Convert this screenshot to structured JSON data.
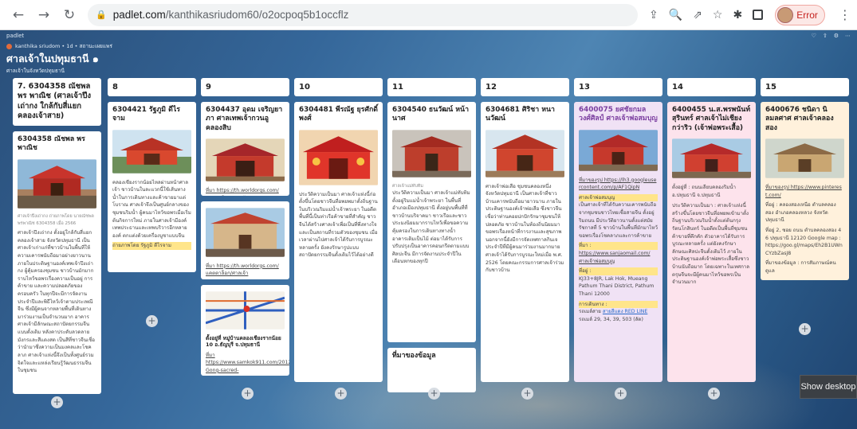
{
  "browser": {
    "url_domain": "padlet.com",
    "url_path": "/kanthikasriudom60/o2ocpoq5b1occflz",
    "profile_label": "Error"
  },
  "padlet": {
    "brand": "padlet",
    "meta_line": "kanthika sriudom • 1d • สถานะเผยแพร่",
    "title": "ศาลเจ้าในปทุมธานี ๑",
    "subtitle": "ศาลเจ้าในจังหวัดปทุมธานี"
  },
  "columns": [
    {
      "title": "7. 6304358 ณัชพล พร พาณิช (ศาลเจ้าปึงเถ่ากง ใกล้กับสี่แยกคลองเจ้าสาย)",
      "cards": [
        {
          "title": "6304358 ณัชพล พรพาณิช",
          "caption": "ศาลเจ้าปึงเถ่ากง ถ่ายภาพโดย นายณัชพล พรพาณิช 6304358 เมื่อ 2566",
          "body": "ศาลเจ้าปึงเถ่ากง ตั้งอยู่ใกล้กับสี่แยกคลองเจ้าสาย จังหวัดปทุมธานี เป็นศาลเจ้าเก่าแก่ที่ชาวบ้านในพื้นที่ให้ความเคารพนับถือมาอย่างยาวนาน ภายในประดิษฐานองค์เทพเจ้าปึงเถ่ากง ผู้คุ้มครองชุมชน ชาวบ้านมักมากราบไหว้ขอพรเรื่องความเป็นอยู่ การค้าขาย และความปลอดภัยของครอบครัว ในทุกปีจะมีการจัดงานประจำปีและพิธีไหว้เจ้าตามประเพณีจีน ซึ่งมีผู้คนจากหลายพื้นที่เดินทางมาร่วมงานเป็นจำนวนมาก อาคารศาลเจ้ามีลักษณะสถาปัตยกรรมจีนแบบดั้งเดิม หลังคาประดับลวดลายมังกรและสีแดงสด เป็นสีที่ชาวจีนเชื่อว่านำมาซึ่งความเป็นมงคลและโชคลาภ ศาลเจ้าแห่งนี้จึงเป็นทั้งศูนย์รวมจิตใจและแหล่งเรียนรู้วัฒนธรรมจีนในชุมชน"
        },
        {
          "title": "",
          "caption": "",
          "body": "ศาลเจ้าปึงเถ่ากง",
          "footer": "ศาลเจ้าปึงเถ่ากง"
        }
      ]
    },
    {
      "title": "8",
      "cards": [
        {
          "title": "6304421 รัฐภูมิ ดีไรจาม",
          "body": "คลองเชียงรากน้อยไหลผ่านหน้าศาลเจ้า ชาวบ้านในละแวกนี้ใช้เส้นทางน้ำในการเดินทางและค้าขายมาแต่โบราณ ศาลเจ้าจึงเป็นศูนย์กลางของชุมชนริมน้ำ ผู้คนมาไหว้ขอพรเมื่อเริ่มต้นกิจการใหม่ ภายในศาลเจ้ามีองค์เทพประธานและเทพบริวารอีกหลายองค์ ตกแต่งด้วยเครื่องบูชาแบบจีน",
          "note": "ถ่ายภาพโดย รัฐภูมิ ดีไรจาม"
        }
      ]
    },
    {
      "title": "9",
      "cards": [
        {
          "title": "6304437 อุดม เจริญยาภา ศาลเทพเจ้ากวนอูคลองสิบ",
          "link": "ที่มา https://th.worldorgs.com/แคตตาล็อก/ศาลเจ้ากวนอูคลองสิบ"
        },
        {
          "title": "",
          "link": "ที่มา https://th.worldorgs.com/แคตตาล็อก/ศาลเจ้า"
        },
        {
          "title": "ตั้งอยู่ที่ หมู่บ้านคลองเชียงรากน้อย 10 อ.ธัญบุรี จ.ปทุมธานี",
          "link": "ที่มา https://www.samkok911.com/2012/12/Guan-Gong-sacred-"
        }
      ]
    },
    {
      "title": "10",
      "cards": [
        {
          "title": "6304481 พีรณัฐ ยุรศักดิ์พงศ์",
          "body": "ประวัติความเป็นมา ศาลเจ้าแห่งนี้ก่อตั้งขึ้นโดยชาวจีนที่อพยพมาตั้งถิ่นฐานในบริเวณริมแม่น้ำเจ้าพระยา ในอดีตพื้นที่นี้เป็นท่าเรือค้าขายที่สำคัญ ชาวจีนได้สร้างศาลเจ้าเพื่อเป็นที่พึ่งทางใจ และเป็นสถานที่รวมตัวของชุมชน เมื่อเวลาผ่านไปศาลเจ้าได้รับการบูรณะหลายครั้ง ยังคงรักษารูปแบบสถาปัตยกรรมจีนดั้งเดิมไว้ได้อย่างดี"
        }
      ]
    },
    {
      "title": "11",
      "cards": [
        {
          "title": "6304540 ธนวัฒน์ หน้านาศ",
          "caption": "ศาลเจ้าแม่ทับทิม",
          "body": "ประวัติความเป็นมา ศาลเจ้าแม่ทับทิมตั้งอยู่ริมแม่น้ำเจ้าพระยา ในพื้นที่อำเภอเมืองปทุมธานี ตั้งอยู่บนพื้นที่ที่ชาวบ้านบริจาคมา ชาวเรือและชาวประมงนิยมมากราบไหว้เพื่อขอความคุ้มครองในการเดินทางทางน้ำ อาคารเดิมเป็นไม้ ต่อมาได้รับการปรับปรุงเป็นอาคารคอนกรีตตามแบบศิลปะจีน มีการจัดงานประจำปีในเดือนหกของทุกปี"
        },
        {
          "title": "ที่มาของข้อมูล"
        }
      ]
    },
    {
      "title": "12",
      "cards": [
        {
          "title": "6304681 ศิริชา หนานวัฒน์",
          "body": "ศาลเจ้าพ่อเสือ ชุมชนคลองหนึ่ง จังหวัดปทุมธานี เป็นศาลเจ้าที่ชาวบ้านเคารพนับถือมายาวนาน ภายในประดิษฐานองค์เจ้าพ่อเสือ ซึ่งชาวจีนเชื่อว่าท่านคอยปกปักรักษาชุมชนให้ปลอดภัย ชาวบ้านในท้องถิ่นนิยมมาขอพรเรื่องหน้าที่การงานและสุขภาพ นอกจากนี้ยังมีการจัดเทศกาลกินเจประจำปีที่มีผู้คนมาร่วมงานมากมาย ศาลเจ้าได้รับการบูรณะใหม่เมื่อ พ.ศ. 2526 โดยคณะกรรมการศาลเจ้าร่วมกับชาวบ้าน"
        }
      ]
    },
    {
      "title": "13",
      "cards": [
        {
          "title": "6400075 ยศชัยกมล วงศ์ศิลป์ ศาลเจ้าพ่อสมบุญ",
          "link": "ที่มาของรูป https://lh3.googleusercontent.com/p/AF1QipN",
          "label1": "ศาลเจ้าพ่อสมบุญ",
          "body": "เป็นศาลเจ้าที่ได้รับความเคารพนับถือจากชุมชนชาวไทยเชื้อสายจีน ตั้งอยู่ริมถนน มีประวัติยาวนานตั้งแต่สมัยรัชกาลที่ 5 ชาวบ้านในพื้นที่มักมาไหว้ขอพรเรื่องโชคลาภและการค้าขาย",
          "label2": "ที่มา :",
          "link2": "https://www.sanjaomail.com/ศาลเจ้าพ่อสมบุญ",
          "label3": "ที่อยู่ :",
          "address": "KJ33+8JR, Lak Hok, Mueang Pathum Thani District, Pathum Thani 12000",
          "label4": "การเดินทาง :",
          "label5": "รถเมล์สาย",
          "transit": "สายสีแดง RED LINE",
          "bus": "รถเมล์ 29, 34, 39, 503 (ลัด)"
        }
      ]
    },
    {
      "title": "14",
      "cards": [
        {
          "title": "6400455 น.ส.พรพนันท์ สุรินทร์ ศาลเจ้าไม่เชียงกว่าริว (เจ้าพ่อพระเสื้อ)",
          "address": "ตั้งอยู่ที่ : ถนนเลียบคลองริมน้ำ อ.ปทุมธานี จ.ปทุมธานี",
          "body": "ประวัติความเป็นมา : ศาลเจ้าแห่งนี้สร้างขึ้นโดยชาวจีนที่อพยพเข้ามาตั้งถิ่นฐานบริเวณริมน้ำตั้งแต่ต้นกรุงรัตนโกสินทร์ ในอดีตเป็นพื้นที่ชุมชนค้าขายที่คึกคัก ตัวอาคารได้รับการบูรณะหลายครั้ง แต่ยังคงรักษาลักษณะศิลปะจีนดั้งเดิมไว้ ภายในประดิษฐานองค์เจ้าพ่อพระเสื้อซึ่งชาวบ้านนับถือมาก โดยเฉพาะในเทศกาลตรุษจีนจะมีผู้คนมาไหว้ขอพรเป็นจำนวนมาก"
        }
      ]
    },
    {
      "title": "15",
      "cards": [
        {
          "title": "6400676 ชนิดา นิลมลศาศ ศาลเจ้าคลองสอง",
          "link": "ที่มาของรูป https://www.pinterest.com/",
          "address": "ที่อยู่ : คลองสองเหนือ ตำบลคลองสอง อำเภอคลองหลวง จังหวัดปทุมธานี",
          "map": "ที่อยู่ 2, ซอย ถนน ตำบลคลองสอง 46 ปทุมธานี 12120 Google map : https://goo.gl/maps/Eh2B1UWnCYzbZasJ8",
          "note": "ที่มาของข้อมูล : การสัมภาษณ์คนดูแล"
        }
      ]
    }
  ],
  "taskbar": {
    "show_desktop": "Show desktop"
  }
}
